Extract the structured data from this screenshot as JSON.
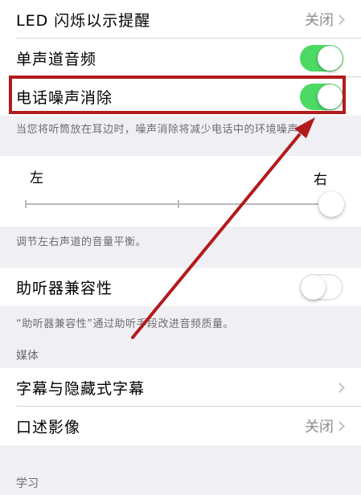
{
  "rows": {
    "led_flash": {
      "label": "LED 闪烁以示提醒",
      "value": "关闭"
    },
    "mono_audio": {
      "label": "单声道音频",
      "toggle": "on"
    },
    "phone_noise_cancel": {
      "label": "电话噪声消除",
      "toggle": "on"
    },
    "hearing_aid": {
      "label": "助听器兼容性",
      "toggle": "off"
    },
    "subtitles": {
      "label": "字幕与隐藏式字幕"
    },
    "audio_description": {
      "label": "口述影像",
      "value": "关闭"
    }
  },
  "notes": {
    "noise_cancel": "当您将听筒放在耳边时，噪声消除将减少电话中的环境噪声。",
    "balance": "调节左右声道的音量平衡。",
    "hearing_aid": "“助听器兼容性”通过助听手段改进音频质量。"
  },
  "balance": {
    "left_label": "左",
    "right_label": "右",
    "value": 1.0
  },
  "section_headers": {
    "media": "媒体",
    "learning": "学习"
  },
  "annotation": {
    "color": "#b21b1b"
  },
  "colors": {
    "toggle_on": "#4cd964",
    "background": "#efeff4"
  }
}
